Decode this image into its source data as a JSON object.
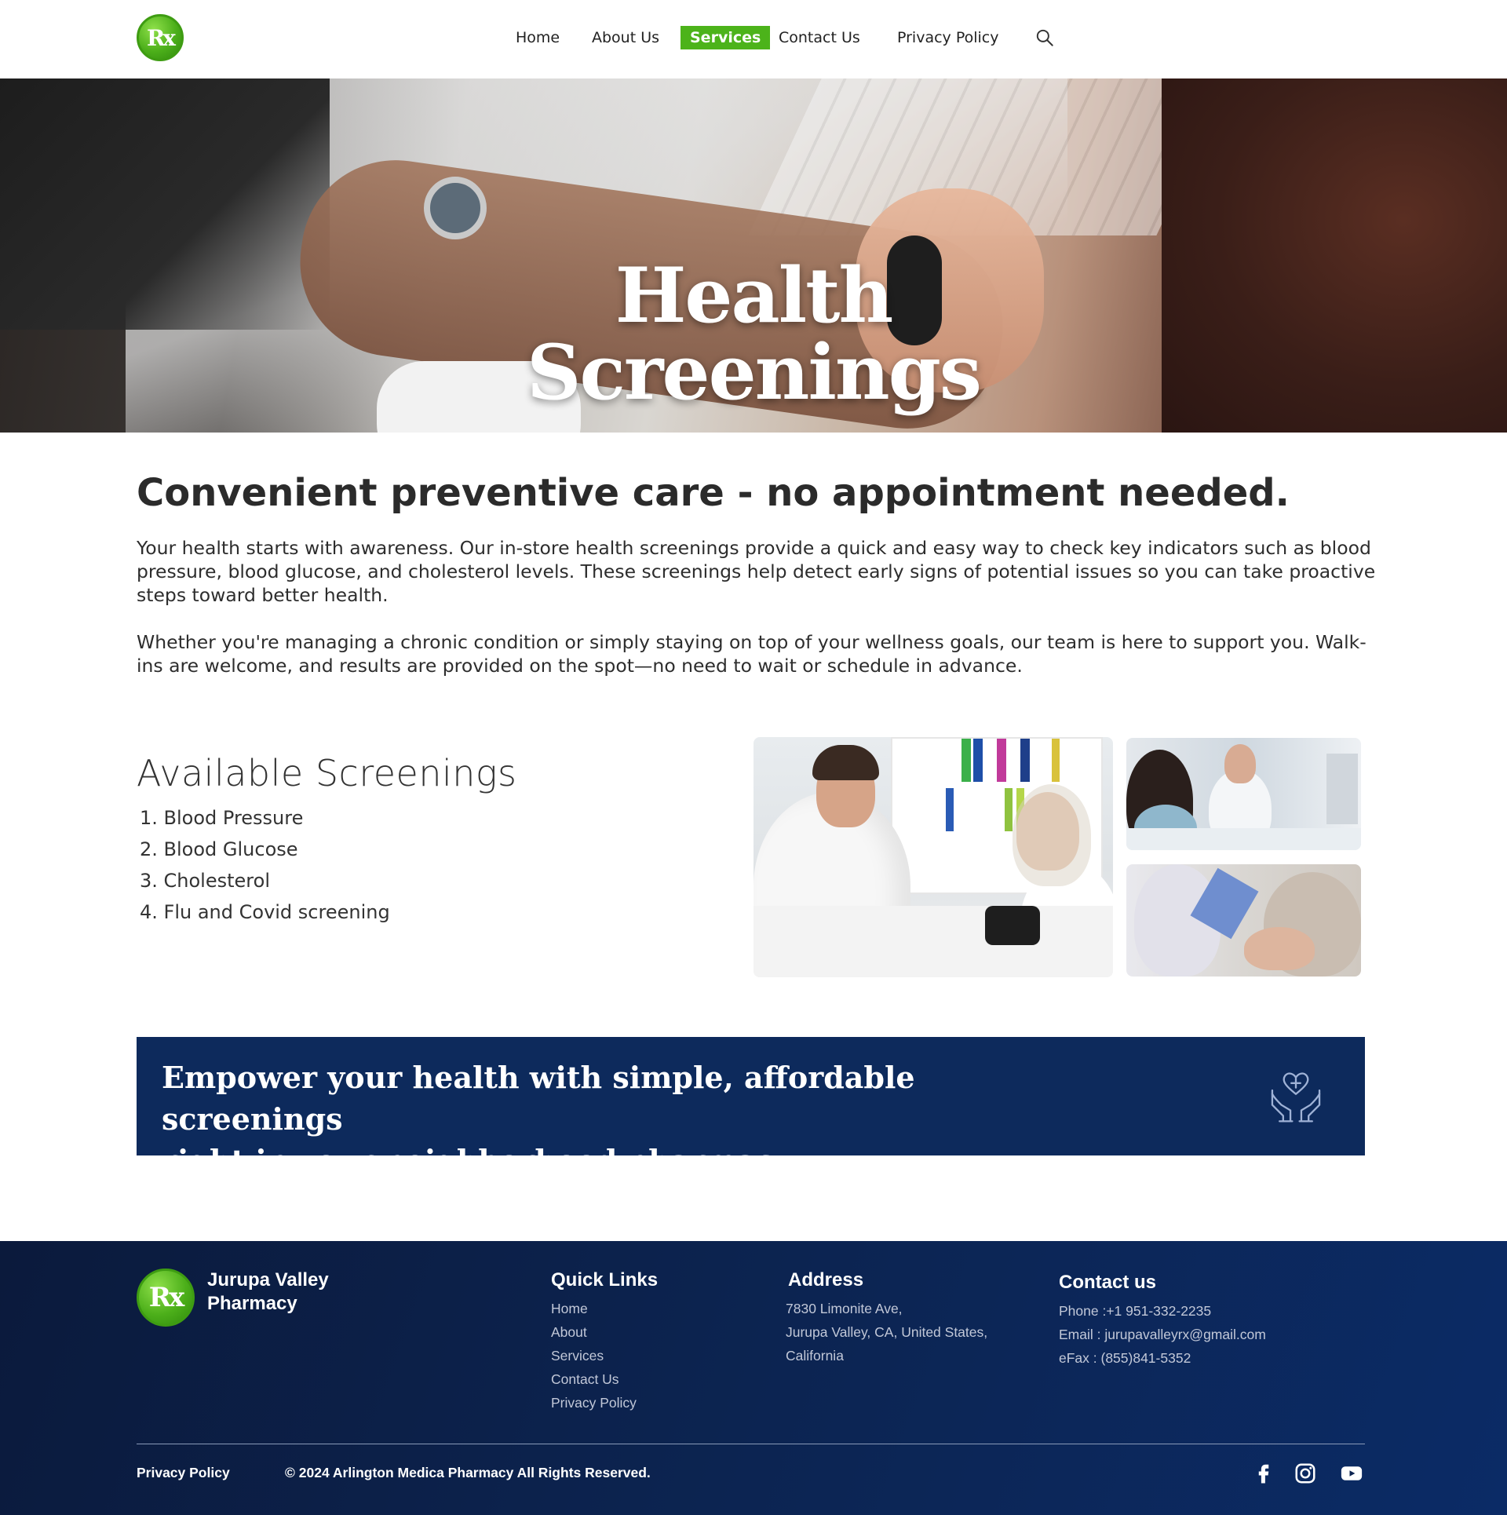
{
  "header": {
    "logo_text": "Rx",
    "nav": [
      {
        "label": "Home"
      },
      {
        "label": "About Us"
      },
      {
        "label": "Services"
      },
      {
        "label": "Contact Us"
      },
      {
        "label": "Privacy Policy"
      }
    ],
    "active_nav": "Services",
    "accent_color": "#4cb31a",
    "search_icon": "search-icon"
  },
  "hero": {
    "title_line1": "Health",
    "title_line2": "Screenings"
  },
  "intro": {
    "title": "Convenient preventive care - no appointment needed.",
    "p1": "Your health starts with awareness. Our in-store health screenings provide a quick and easy way to check key indicators such as blood pressure, blood glucose, and cholesterol levels. These screenings help detect early signs of potential issues so you can take proactive steps toward better health.",
    "p2": "Whether you're managing a chronic condition or simply staying on top of your wellness goals, our team is here to support you. Walk-ins are welcome, and results are provided on the spot—no need to wait or schedule in advance."
  },
  "screenings": {
    "title": "Available Screenings",
    "items": [
      "1.  Blood Pressure",
      "2.  Blood Glucose",
      "3.  Cholesterol",
      "4.  Flu and Covid screening"
    ]
  },
  "banner": {
    "line1": "Empower your health with simple, affordable screenings",
    "line2": "right in your neighborhood pharmacy.",
    "background_color": "#0d2a5c",
    "icon": "hands-heart-care-icon"
  },
  "footer": {
    "logo_text": "Rx",
    "name_line1": "Jurupa Valley",
    "name_line2": "Pharmacy",
    "quick_links": {
      "heading": "Quick Links",
      "links": [
        "Home",
        "About",
        "Services",
        "Contact Us",
        "Privacy Policy"
      ]
    },
    "address": {
      "heading": "Address",
      "lines": [
        "7830 Limonite Ave,",
        "Jurupa Valley, CA, United States,",
        "California"
      ]
    },
    "contact": {
      "heading": "Contact us",
      "phone": "Phone :+1 951-332-2235",
      "email": "Email : jurupavalleyrx@gmail.com",
      "fax": "eFax : (855)841-5352"
    },
    "bottom": {
      "privacy": "Privacy Policy",
      "copyright": "© 2024 Arlington Medica Pharmacy All Rights Reserved."
    },
    "social_icons": [
      "facebook-icon",
      "instagram-icon",
      "youtube-icon"
    ]
  }
}
